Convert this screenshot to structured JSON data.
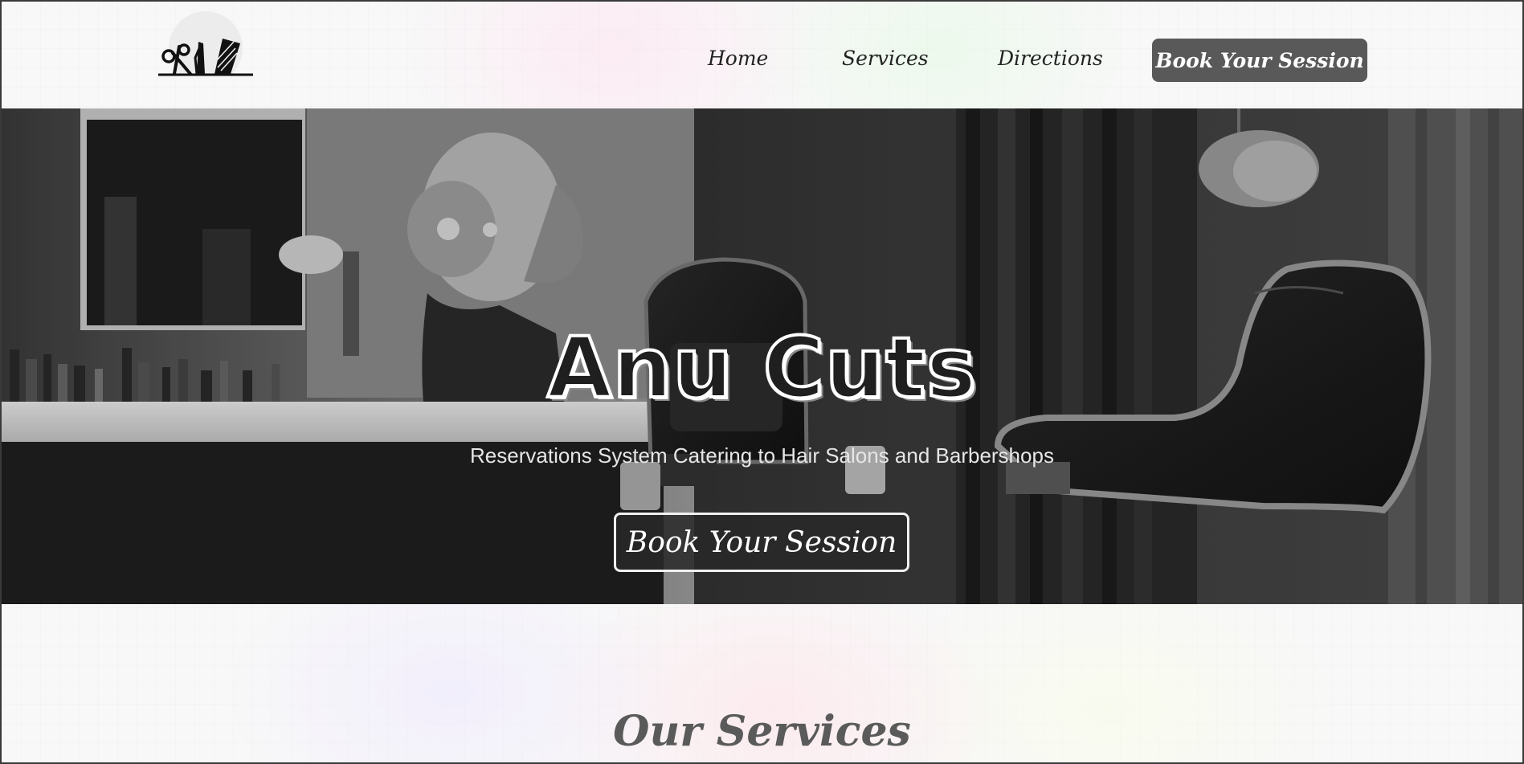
{
  "header": {
    "logo_icon": "scissors-comb-razor-icon",
    "nav": {
      "home": "Home",
      "services": "Services",
      "directions": "Directions",
      "cta": "Book Your Session"
    }
  },
  "hero": {
    "title": "Anu Cuts",
    "subtitle": "Reservations System Catering to Hair Salons and Barbershops",
    "cta": "Book Your Session"
  },
  "services": {
    "heading": "Our Services"
  },
  "colors": {
    "nav_cta_bg": "#595959",
    "hero_overlay": "#2b2b2b",
    "heading_text": "#5a5a5a"
  }
}
